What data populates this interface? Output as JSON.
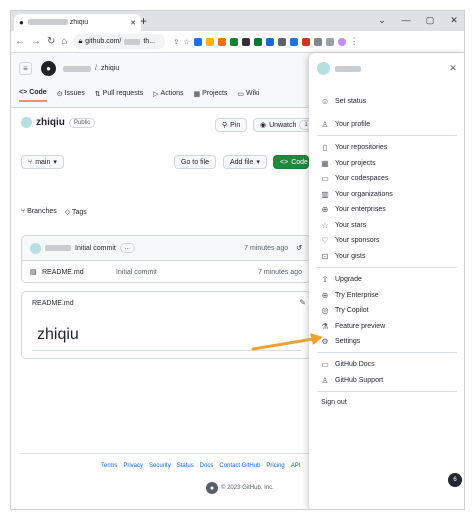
{
  "browser": {
    "tab_title": "zhiqiu",
    "url": "github.com/",
    "url_tail": "th...",
    "new_tab": "+",
    "controls": [
      "⌄",
      "—",
      "▢",
      "✕"
    ]
  },
  "header": {
    "repo_name": "zhiqiu",
    "slash": "/",
    "tabs": [
      {
        "label": "Code",
        "active": true
      },
      {
        "label": "Issues"
      },
      {
        "label": "Pull requests"
      },
      {
        "label": "Actions"
      },
      {
        "label": "Projects"
      },
      {
        "label": "Wiki"
      }
    ]
  },
  "repo": {
    "title": "zhiqiu",
    "visibility": "Public",
    "pin_label": "Pin",
    "unwatch_label": "Unwatch",
    "watch_count": "1",
    "branch": "main",
    "goto_file": "Go to file",
    "add_file": "Add file",
    "code_btn": "Code",
    "branches": "Branches",
    "tags": "Tags"
  },
  "commit": {
    "message": "Initial commit",
    "dots": "...",
    "time": "7 minutes ago"
  },
  "files": [
    {
      "name": "README.md",
      "commit": "Initial commit",
      "time": "7 minutes ago"
    }
  ],
  "readme": {
    "label": "README.md",
    "heading": "zhiqiu"
  },
  "footer": {
    "links": [
      "Terms",
      "Privacy",
      "Security",
      "Status",
      "Docs",
      "Contact GitHub",
      "Pricing",
      "API"
    ],
    "copyright": "© 2023 GitHub, Inc."
  },
  "menu": {
    "groups": [
      [
        {
          "label": "Set status",
          "icon": "smiley-icon"
        },
        {
          "label": "Your profile",
          "icon": "person-icon"
        }
      ],
      [
        {
          "label": "Your repositories",
          "icon": "repo-icon"
        },
        {
          "label": "Your projects",
          "icon": "table-icon"
        },
        {
          "label": "Your codespaces",
          "icon": "codespaces-icon"
        },
        {
          "label": "Your organizations",
          "icon": "org-icon"
        },
        {
          "label": "Your enterprises",
          "icon": "globe-icon"
        },
        {
          "label": "Your stars",
          "icon": "star-icon"
        },
        {
          "label": "Your sponsors",
          "icon": "heart-icon"
        },
        {
          "label": "Your gists",
          "icon": "code-square-icon"
        }
      ],
      [
        {
          "label": "Upgrade",
          "icon": "upload-icon"
        },
        {
          "label": "Try Enterprise",
          "icon": "globe-icon"
        },
        {
          "label": "Try Copilot",
          "icon": "copilot-icon"
        },
        {
          "label": "Feature preview",
          "icon": "beaker-icon"
        },
        {
          "label": "Settings",
          "icon": "gear-icon"
        }
      ],
      [
        {
          "label": "GitHub Docs",
          "icon": "book-icon"
        },
        {
          "label": "GitHub Support",
          "icon": "people-icon"
        }
      ],
      [
        {
          "label": "Sign out",
          "icon": ""
        }
      ]
    ],
    "close": "✕"
  },
  "fab_count": "6",
  "colors": {
    "green": "#1f883d",
    "link": "#0969da",
    "arrow": "#f0a030"
  }
}
